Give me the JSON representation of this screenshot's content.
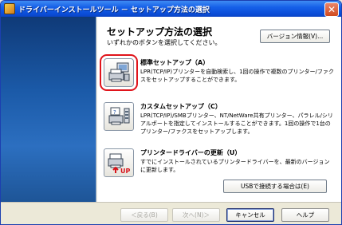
{
  "window": {
    "title": "ドライバーインストールツール － セットアップ方法の選択",
    "close_glyph": "✕"
  },
  "header": {
    "title": "セットアップ方法の選択",
    "subtitle": "いずれかのボタンを選択してください。",
    "version_button": "バージョン情報(V)..."
  },
  "options": [
    {
      "title": "標準セットアップ（A）",
      "description": "LPR(TCP/IP)プリンターを自動検索し、1回の操作で複数のプリンター/ファクスをセットアップすることができます。",
      "icon": "printer-computer-icon",
      "selected": true
    },
    {
      "title": "カスタムセットアップ（C）",
      "description": "LPR(TCP/IP)/SMBプリンター、NT/NetWare共有プリンター、パラレル/シリアルポートを指定してインストールすることができます。1回の操作で1台のプリンター/ファクスをセットアップします。",
      "icon": "printer-custom-icon",
      "selected": false
    },
    {
      "title": "プリンタードライバーの更新（U）",
      "description": "すでにインストールされているプリンタードライバーを、最新のバージョンに更新します。",
      "icon": "printer-update-icon",
      "icon_badge": "UP",
      "selected": false
    }
  ],
  "usb_button": "USBで接続する場合は(E)",
  "footer": {
    "back": "＜戻る(B)",
    "next": "次へ(N)＞",
    "cancel": "キャンセル",
    "help": "ヘルプ"
  },
  "colors": {
    "title_bar": "#0a4bd6",
    "sidebar": "#1b5aa8",
    "selection_outline": "#e0141b",
    "close_button": "#d04a1f"
  }
}
